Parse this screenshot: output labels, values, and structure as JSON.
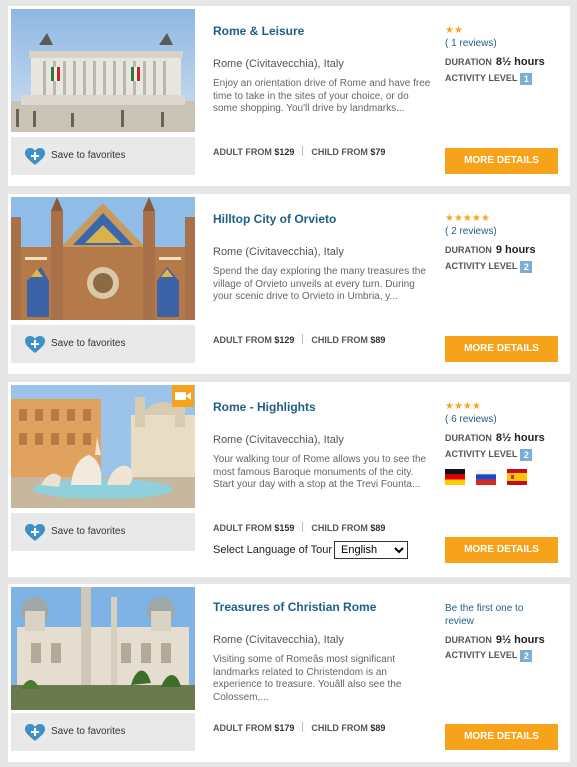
{
  "ui": {
    "favorites_label": "Save to favorites",
    "adult_label": "ADULT FROM",
    "child_label": "CHILD FROM",
    "duration_label": "DURATION",
    "activity_label": "ACTIVITY LEVEL",
    "more_label": "MORE DETAILS",
    "accent_color": "#f6a21b",
    "title_color": "#1f5f84"
  },
  "tours": [
    {
      "title": "Rome & Leisure",
      "location": "Rome (Civitavecchia), Italy",
      "description": "Enjoy an orientation drive of Rome and have free time to take in the sites of your choice, or do some shopping. You'll drive by landmarks...",
      "stars": "★★",
      "rating": 2,
      "reviews": "( 1 reviews)",
      "duration": "8½ hours",
      "activity_level": "1",
      "adult_price": "$129",
      "child_price": "$79",
      "image": "rome-monument-photo"
    },
    {
      "title": "Hilltop City of Orvieto",
      "location": "Rome (Civitavecchia), Italy",
      "description": "Spend the day exploring the many treasures the village of Orvieto unveils at every turn. During your scenic drive to Orvieto in Umbria, y...",
      "stars": "★★★★★",
      "rating": 5,
      "reviews": "( 2 reviews)",
      "duration": "9 hours",
      "activity_level": "2",
      "adult_price": "$129",
      "child_price": "$89",
      "image": "orvieto-cathedral-photo"
    },
    {
      "title": "Rome - Highlights",
      "location": "Rome (Civitavecchia), Italy",
      "description": "Your walking tour of Rome allows you to see the most famous Baroque monuments of the city. Start your day with a stop at the Trevi Founta...",
      "stars": "★★★★",
      "rating": 4,
      "reviews": "( 6 reviews)",
      "duration": "8½ hours",
      "activity_level": "2",
      "adult_price": "$159",
      "child_price": "$89",
      "image": "piazza-navona-fountain-photo",
      "has_video": true,
      "languages": [
        "german-flag",
        "russian-flag",
        "spanish-flag"
      ],
      "language_label": "Select Language of Tour",
      "language_selected": "English"
    },
    {
      "title": "Treasures of Christian Rome",
      "location": "Rome (Civitavecchia), Italy",
      "description": "Visiting some of Romeâs most significant landmarks related to Christendom is an experience to treasure. Youâll also see the Colossem,...",
      "first_review": "Be the first one to review",
      "duration": "9½ hours",
      "activity_level": "2",
      "adult_price": "$179",
      "child_price": "$89",
      "image": "santa-maria-maggiore-photo"
    }
  ]
}
